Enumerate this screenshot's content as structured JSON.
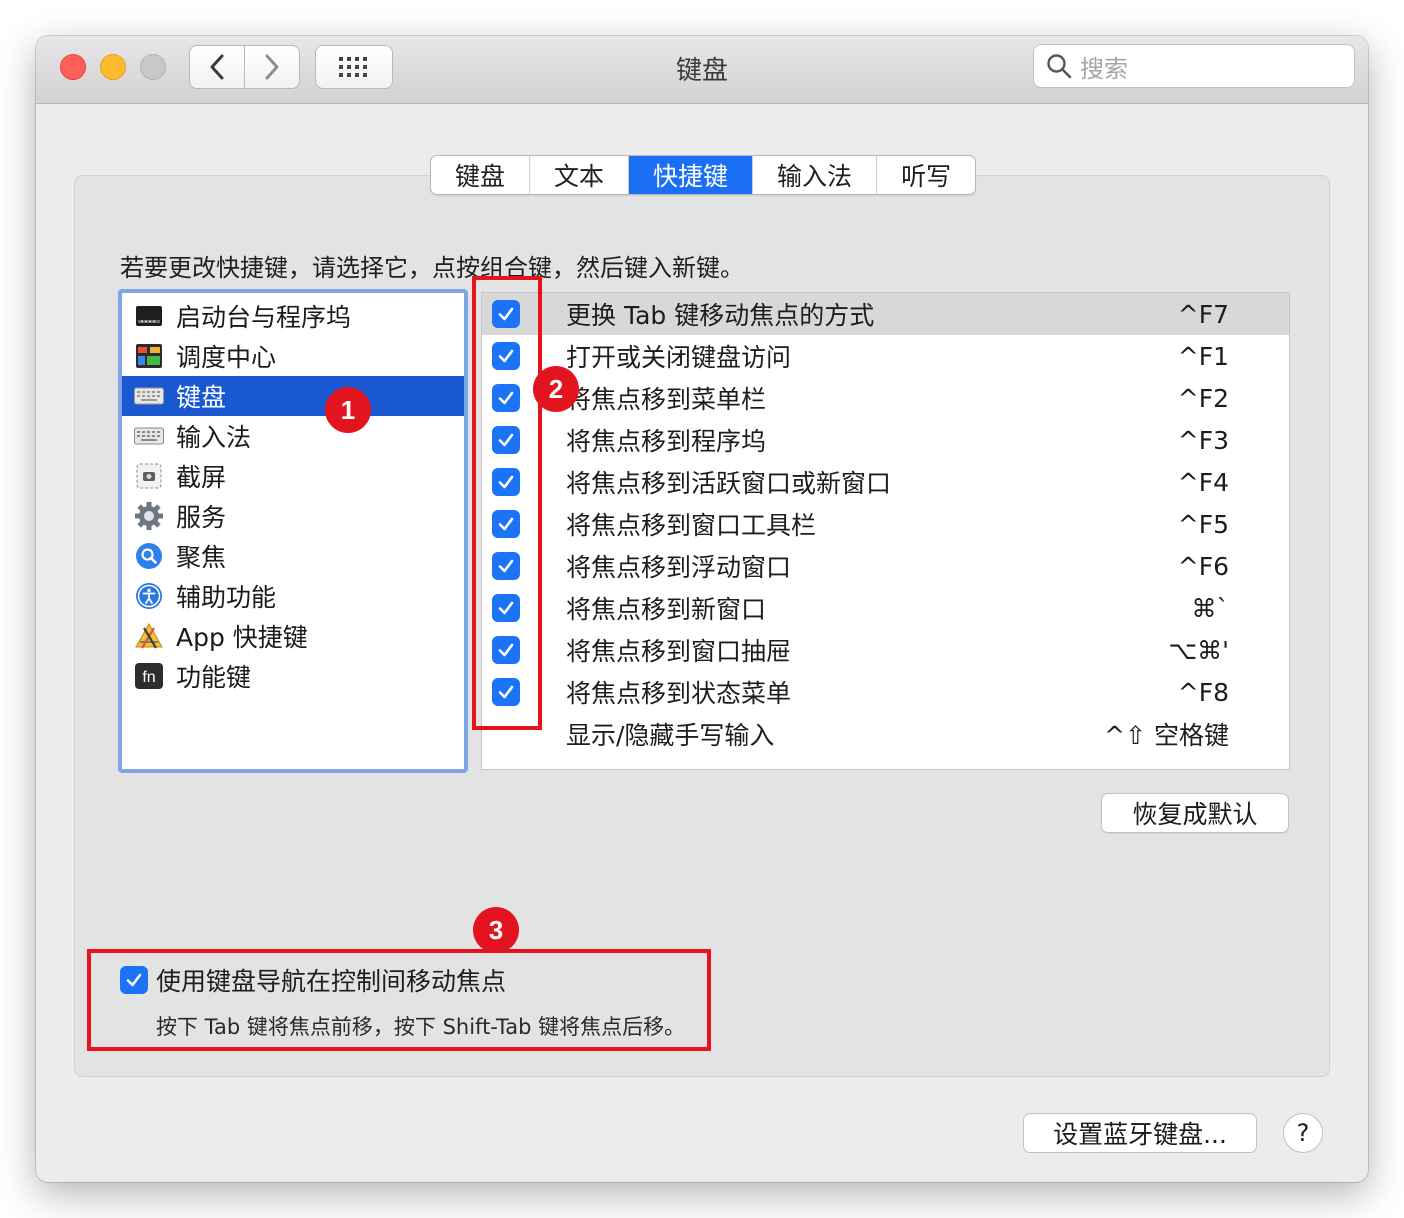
{
  "window": {
    "title": "键盘",
    "search_placeholder": "搜索"
  },
  "tabs": [
    {
      "label": "键盘",
      "active": false
    },
    {
      "label": "文本",
      "active": false
    },
    {
      "label": "快捷键",
      "active": true
    },
    {
      "label": "输入法",
      "active": false
    },
    {
      "label": "听写",
      "active": false
    }
  ],
  "instruction": "若要更改快捷键，请选择它，点按组合键，然后键入新键。",
  "categories": [
    {
      "label": "启动台与程序坞",
      "icon": "launchpad-dock-icon",
      "selected": false
    },
    {
      "label": "调度中心",
      "icon": "mission-control-icon",
      "selected": false
    },
    {
      "label": "键盘",
      "icon": "keyboard-icon",
      "selected": true
    },
    {
      "label": "输入法",
      "icon": "input-source-icon",
      "selected": false
    },
    {
      "label": "截屏",
      "icon": "screenshot-icon",
      "selected": false
    },
    {
      "label": "服务",
      "icon": "gear-icon",
      "selected": false
    },
    {
      "label": "聚焦",
      "icon": "spotlight-icon",
      "selected": false
    },
    {
      "label": "辅助功能",
      "icon": "accessibility-icon",
      "selected": false
    },
    {
      "label": "App 快捷键",
      "icon": "app-shortcuts-icon",
      "selected": false
    },
    {
      "label": "功能键",
      "icon": "fn-key-icon",
      "selected": false
    }
  ],
  "shortcuts": [
    {
      "label": "更换 Tab 键移动焦点的方式",
      "key": "^F7",
      "checked": true
    },
    {
      "label": "打开或关闭键盘访问",
      "key": "^F1",
      "checked": true
    },
    {
      "label": "将焦点移到菜单栏",
      "key": "^F2",
      "checked": true
    },
    {
      "label": "将焦点移到程序坞",
      "key": "^F3",
      "checked": true
    },
    {
      "label": "将焦点移到活跃窗口或新窗口",
      "key": "^F4",
      "checked": true
    },
    {
      "label": "将焦点移到窗口工具栏",
      "key": "^F5",
      "checked": true
    },
    {
      "label": "将焦点移到浮动窗口",
      "key": "^F6",
      "checked": true
    },
    {
      "label": "将焦点移到新窗口",
      "key": "⌘`",
      "checked": true
    },
    {
      "label": "将焦点移到窗口抽屉",
      "key": "⌥⌘'",
      "checked": true
    },
    {
      "label": "将焦点移到状态菜单",
      "key": "^F8",
      "checked": true
    },
    {
      "label": "显示/隐藏手写输入",
      "key": "^⇧ 空格键",
      "checked": false
    }
  ],
  "restore_defaults_label": "恢复成默认",
  "keyboard_nav": {
    "label": "使用键盘导航在控制间移动焦点",
    "checked": true,
    "help": "按下 Tab 键将焦点前移，按下 Shift-Tab 键将焦点后移。"
  },
  "bluetooth_button_label": "设置蓝牙键盘...",
  "help_button_label": "?",
  "annotations": [
    "1",
    "2",
    "3"
  ],
  "colors": {
    "accent": "#1a6ff4",
    "selection": "#1958d1",
    "annotation": "#e3141e"
  }
}
